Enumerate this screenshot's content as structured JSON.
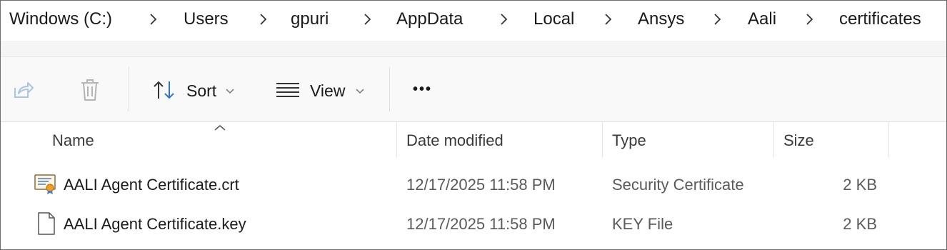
{
  "breadcrumb": {
    "items": [
      "Windows (C:)",
      "Users",
      "gpuri",
      "AppData",
      "Local",
      "Ansys",
      "Aali",
      "certificates"
    ]
  },
  "toolbar": {
    "share_icon": "share-icon",
    "delete_icon": "trash-icon",
    "sort_label": "Sort",
    "view_label": "View",
    "more_label": "•••"
  },
  "columns": {
    "name": "Name",
    "date_modified": "Date modified",
    "type": "Type",
    "size": "Size"
  },
  "files": [
    {
      "name": "AALI Agent Certificate.crt",
      "date_modified": "12/17/2025 11:58 PM",
      "type": "Security Certificate",
      "size": "2 KB",
      "icon": "certificate-file-icon"
    },
    {
      "name": "AALI Agent Certificate.key",
      "date_modified": "12/17/2025 11:58 PM",
      "type": "KEY File",
      "size": "2 KB",
      "icon": "generic-file-icon"
    }
  ],
  "colors": {
    "accent_blue": "#2f76c8",
    "disabled_icon": "#a9c4e4",
    "text": "#1a1a1a",
    "muted_text": "#5a5a5a"
  }
}
